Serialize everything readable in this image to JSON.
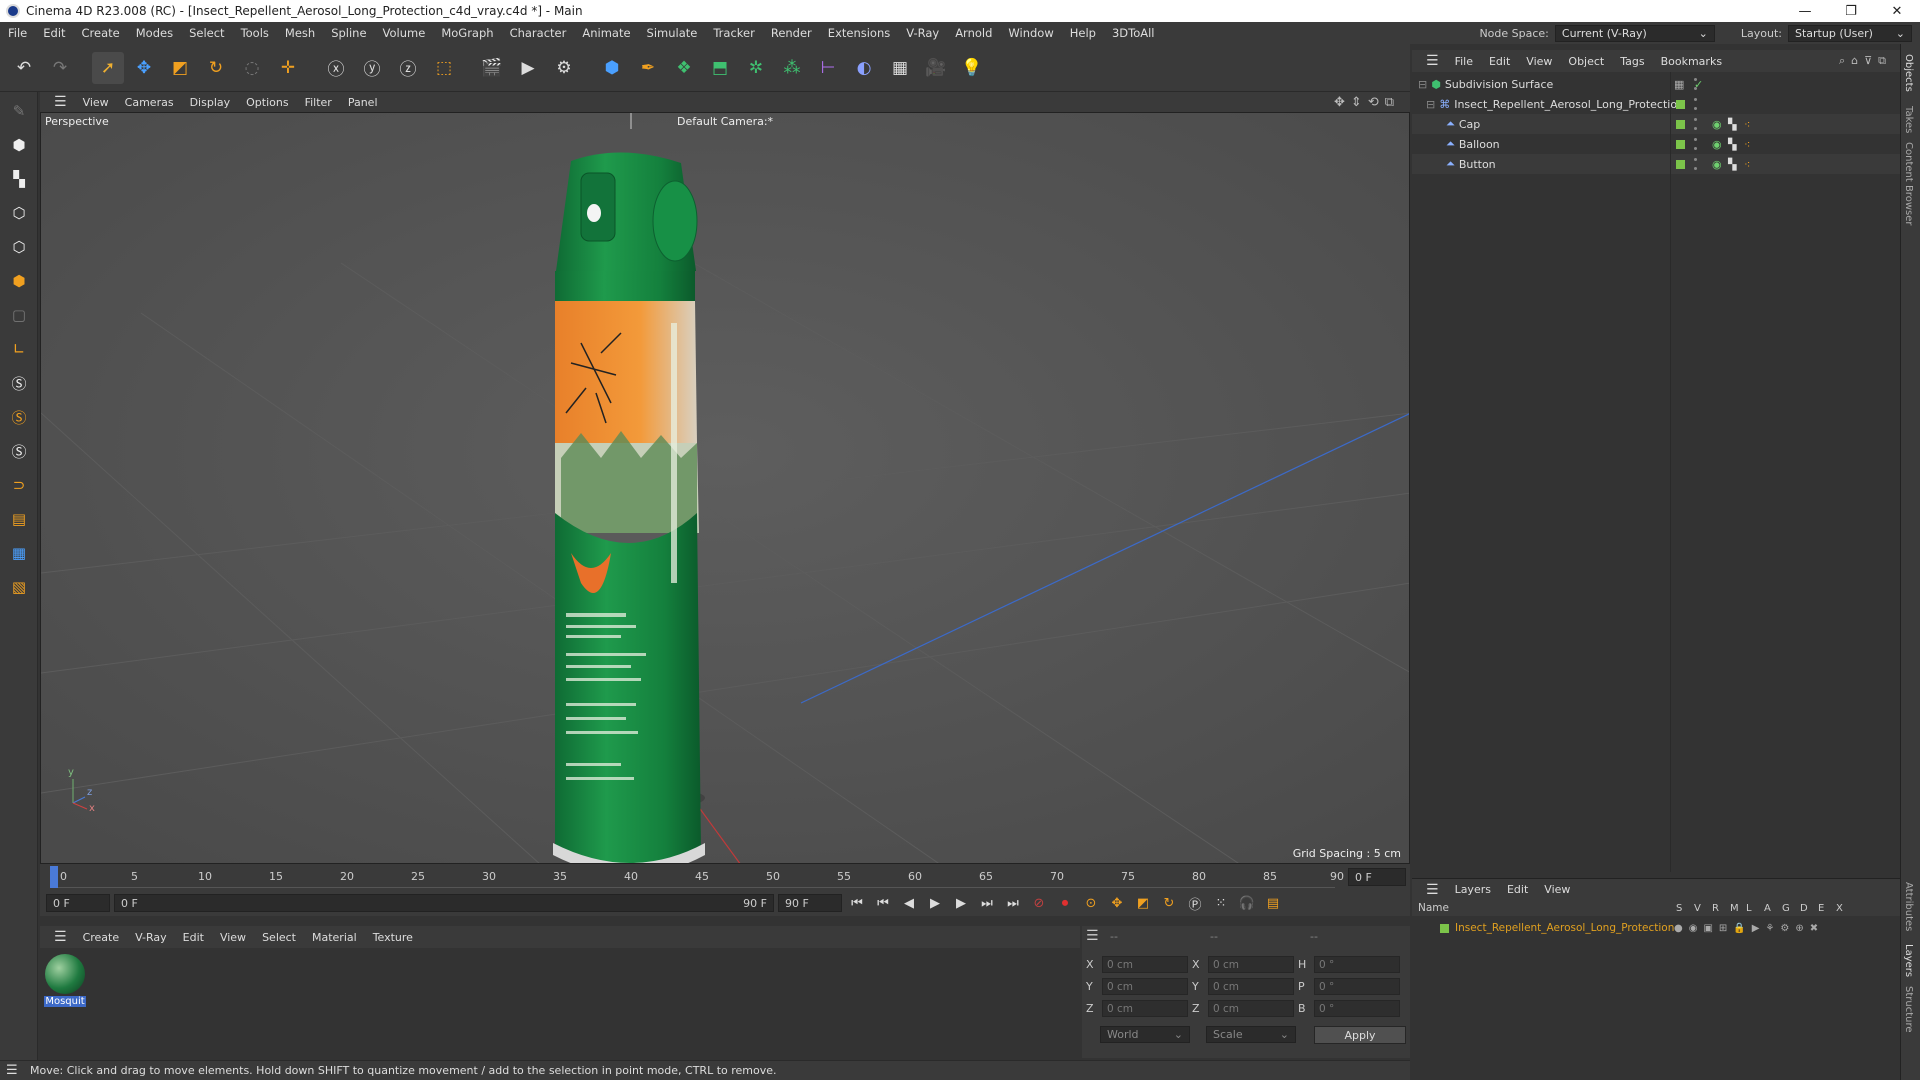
{
  "window": {
    "title": "Cinema 4D R23.008 (RC) - [Insect_Repellent_Aerosol_Long_Protection_c4d_vray.c4d *] - Main",
    "min": "—",
    "max": "❐",
    "close": "✕"
  },
  "menubar": {
    "items": [
      "File",
      "Edit",
      "Create",
      "Modes",
      "Select",
      "Tools",
      "Mesh",
      "Spline",
      "Volume",
      "MoGraph",
      "Character",
      "Animate",
      "Simulate",
      "Tracker",
      "Render",
      "Extensions",
      "V-Ray",
      "Arnold",
      "Window",
      "Help",
      "3DToAll"
    ],
    "node_space_label": "Node Space:",
    "node_space_value": "Current (V-Ray)",
    "layout_label": "Layout:",
    "layout_value": "Startup (User)"
  },
  "viewport": {
    "menu": [
      "View",
      "Cameras",
      "Display",
      "Options",
      "Filter",
      "Panel"
    ],
    "view_name": "Perspective",
    "camera": "Default Camera:*",
    "grid_spacing": "Grid Spacing : 5 cm",
    "axis_y": "y",
    "axis_z": "z",
    "axis_x": "x"
  },
  "timeline": {
    "ticks": [
      "0",
      "5",
      "10",
      "15",
      "20",
      "25",
      "30",
      "35",
      "40",
      "45",
      "50",
      "55",
      "60",
      "65",
      "70",
      "75",
      "80",
      "85",
      "90"
    ],
    "current_frame_field": "0 F",
    "start_field": "0 F",
    "range_start": "0 F",
    "range_end": "90 F",
    "end_field": "90 F"
  },
  "material_panel": {
    "menu": [
      "Create",
      "V-Ray",
      "Edit",
      "View",
      "Select",
      "Material",
      "Texture"
    ],
    "materials": [
      {
        "name": "Mosquit"
      }
    ]
  },
  "coordinates": {
    "header": [
      "--",
      "--",
      "--"
    ],
    "rows": [
      {
        "l1": "X",
        "v1": "0 cm",
        "l2": "X",
        "v2": "0 cm",
        "l3": "H",
        "v3": "0 °"
      },
      {
        "l1": "Y",
        "v1": "0 cm",
        "l2": "Y",
        "v2": "0 cm",
        "l3": "P",
        "v3": "0 °"
      },
      {
        "l1": "Z",
        "v1": "0 cm",
        "l2": "Z",
        "v2": "0 cm",
        "l3": "B",
        "v3": "0 °"
      }
    ],
    "world": "World",
    "scale": "Scale",
    "apply": "Apply"
  },
  "status_text": "Move: Click and drag to move elements. Hold down SHIFT to quantize movement / add to the selection in point mode, CTRL to remove.",
  "object_manager": {
    "menu": [
      "File",
      "Edit",
      "View",
      "Object",
      "Tags",
      "Bookmarks"
    ],
    "objects": [
      {
        "name": "Subdivision Surface"
      },
      {
        "name": "Insect_Repellent_Aerosol_Long_Protection"
      },
      {
        "name": "Cap"
      },
      {
        "name": "Balloon"
      },
      {
        "name": "Button"
      }
    ]
  },
  "layers": {
    "menu": [
      "Layers",
      "Edit",
      "View"
    ],
    "columns": [
      "Name",
      "S",
      "V",
      "R",
      "M",
      "L",
      "A",
      "G",
      "D",
      "E",
      "X"
    ],
    "items": [
      {
        "name": "Insect_Repellent_Aerosol_Long_Protection"
      }
    ]
  },
  "side_tabs": [
    "Objects",
    "Takes",
    "Content Browser",
    "Attributes",
    "Layers",
    "Structure"
  ],
  "colors": {
    "accent": "#7cc44a",
    "layer_name": "#e0a020",
    "can_green": "#1f8a45",
    "label_orange": "#e8872a"
  }
}
